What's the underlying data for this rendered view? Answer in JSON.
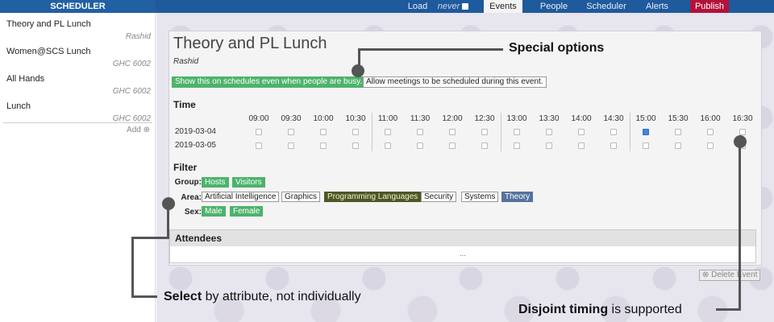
{
  "app": {
    "brand": "SCHEDULER"
  },
  "nav": {
    "load": "Load",
    "never": "never",
    "events": "Events",
    "people": "People",
    "scheduler": "Scheduler",
    "alerts": "Alerts",
    "publish": "Publish"
  },
  "sidebar": {
    "items": [
      {
        "name": "Theory and PL Lunch",
        "sub": "Rashid"
      },
      {
        "name": "Women@SCS Lunch",
        "sub": "GHC 6002"
      },
      {
        "name": "All Hands",
        "sub": "GHC 6002"
      },
      {
        "name": "Lunch",
        "sub": "GHC 6002"
      }
    ],
    "add": "Add ⊕"
  },
  "event": {
    "title": "Theory and PL Lunch",
    "owner": "Rashid",
    "option_show": "Show this on schedules even when people are busy.",
    "option_allow": "Allow meetings to be scheduled during this event."
  },
  "time": {
    "heading": "Time",
    "slots": [
      "09:00",
      "09:30",
      "10:00",
      "10:30",
      "11:00",
      "11:30",
      "12:00",
      "12:30",
      "13:00",
      "13:30",
      "14:00",
      "14:30",
      "15:00",
      "15:30",
      "16:00",
      "16:30"
    ],
    "dates": [
      "2019-03-04",
      "2019-03-05"
    ],
    "checked": [
      [
        12
      ],
      []
    ]
  },
  "filter": {
    "heading": "Filter",
    "group_label": "Group:",
    "group": [
      "Hosts",
      "Visitors"
    ],
    "area_label": "Area:",
    "area": [
      "Artificial Intelligence",
      "Graphics",
      "Programming Languages",
      "Security",
      "Systems",
      "Theory"
    ],
    "sex_label": "Sex:",
    "sex": [
      "Male",
      "Female"
    ]
  },
  "attendees": {
    "heading": "Attendees",
    "more": "..."
  },
  "delete_label": "⊗ Delete Event",
  "callouts": {
    "special": "Special options",
    "select_bold": "Select",
    "select_rest": " by attribute, not individually",
    "disjoint_bold": "Disjoint timing",
    "disjoint_rest": " is supported"
  }
}
